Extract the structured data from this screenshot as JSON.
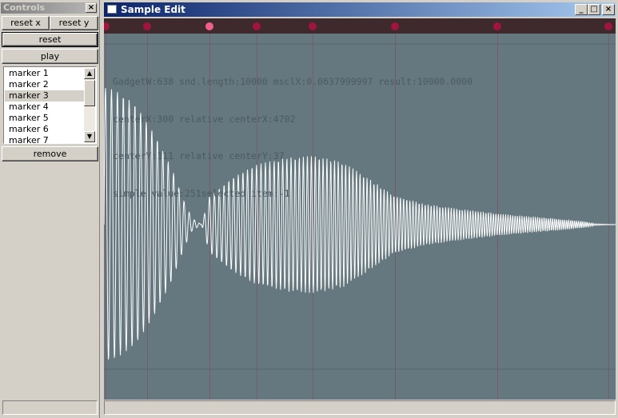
{
  "controls": {
    "title": "Controls",
    "close_glyph": "×",
    "reset_x_label": "reset x",
    "reset_y_label": "reset y",
    "reset_label": "reset",
    "play_label": "play",
    "remove_label": "remove",
    "markers": [
      "marker 1",
      "marker 2",
      "marker 3",
      "marker 4",
      "marker 5",
      "marker 6",
      "marker 7"
    ],
    "selected_marker": "marker 3",
    "scroll_up_glyph": "▲",
    "scroll_down_glyph": "▼"
  },
  "sample_edit": {
    "title": "Sample Edit",
    "minimize_glyph": "_",
    "maximize_glyph": "□",
    "close_glyph": "×",
    "info_lines": [
      "GadgetW:638 snd.length:10000 msclX:0.0637999997 result:10000.0000",
      "centerX:300 relative centerX:4702",
      "centerY:111 relative centerY:37",
      "simple value:251selected item:-1"
    ],
    "marker_dot_color": "#a0153e",
    "selected_marker_dot_color": "#f0608a",
    "marker_bar_color": "#3e2a2c",
    "canvas_color": "#66787f",
    "grid_color": "#7a5a66",
    "waveform_color": "#ffffff"
  }
}
